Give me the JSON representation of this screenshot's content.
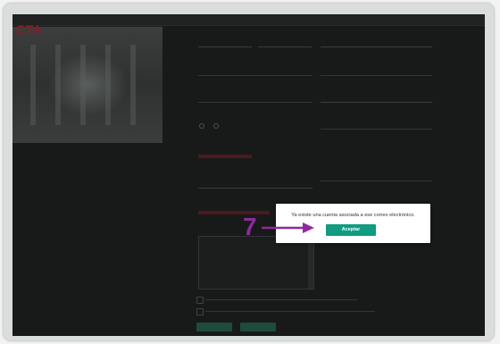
{
  "app": {
    "logo": "CTA"
  },
  "dialog": {
    "message": "Ya existe una cuenta asociada a ese correo electrónico.",
    "ok_label": "Aceptar"
  },
  "annotation": {
    "step_number": "7"
  },
  "colors": {
    "accent": "#0f9c80",
    "annotation": "#8e2a9e",
    "overlay": "#181a19"
  }
}
